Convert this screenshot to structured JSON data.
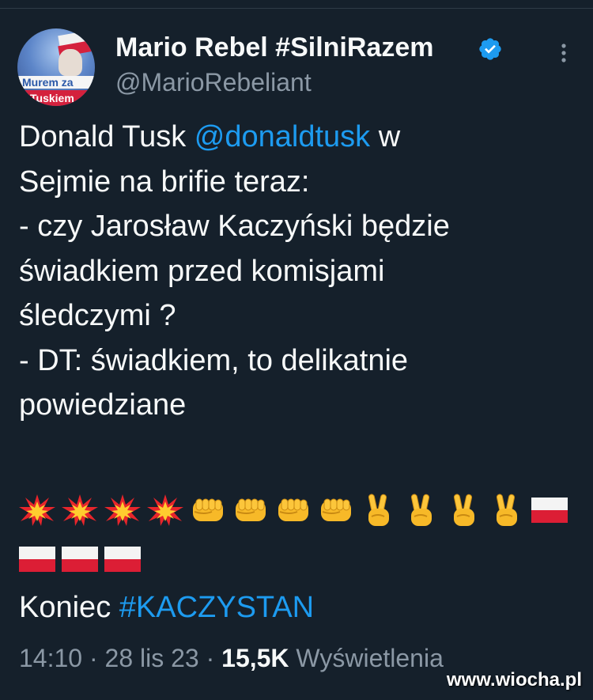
{
  "author": {
    "display_name": "Mario Rebel #SilniRazem",
    "handle": "@MarioRebeliant",
    "verified": true,
    "avatar_text_line1": "Murem za",
    "avatar_text_line2": "Tuskiem"
  },
  "tweet": {
    "line1_pre": "Donald Tusk ",
    "line1_mention": "@donaldtusk",
    "line1_post": " w",
    "body": "Sejmie na brifie teraz:\n- czy Jarosław Kaczyński będzie\nświadkiem przed komisjami\nśledczymi ?\n- DT: świadkiem, to delikatnie\npowiedziane",
    "emoji_row1": [
      "collision",
      "collision",
      "collision",
      "collision",
      "fist",
      "fist",
      "fist",
      "fist",
      "victory-hand",
      "victory-hand",
      "victory-hand",
      "victory-hand",
      "poland-flag"
    ],
    "emoji_row2": [
      "poland-flag",
      "poland-flag",
      "poland-flag"
    ],
    "koniec_text": "Koniec ",
    "hashtag": "#KACZYSTAN"
  },
  "meta": {
    "time": "14:10",
    "date": "28 lis 23",
    "views_count": "15,5K",
    "views_label": "Wyświetlenia",
    "separator": "·"
  },
  "watermark": "www.wiocha.pl",
  "colors": {
    "background": "#15202b",
    "text": "#f7f9f9",
    "secondary": "#8b98a5",
    "link": "#1d9bf0"
  }
}
